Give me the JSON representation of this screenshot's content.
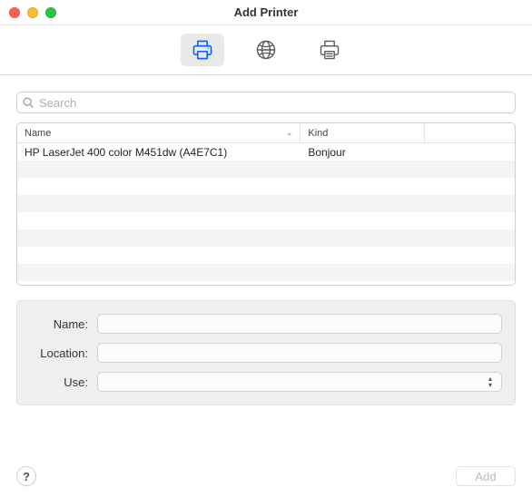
{
  "window": {
    "title": "Add Printer"
  },
  "toolbar": {
    "tabs": [
      {
        "name": "default-printer",
        "active": true
      },
      {
        "name": "ip-printer",
        "active": false
      },
      {
        "name": "windows-printer",
        "active": false
      }
    ]
  },
  "search": {
    "placeholder": "Search",
    "value": ""
  },
  "table": {
    "columns": {
      "name": "Name",
      "kind": "Kind"
    },
    "rows": [
      {
        "name": "HP LaserJet 400 color M451dw (A4E7C1)",
        "kind": "Bonjour"
      }
    ],
    "visible_row_slots": 8
  },
  "details": {
    "labels": {
      "name": "Name:",
      "location": "Location:",
      "use": "Use:"
    },
    "values": {
      "name": "",
      "location": "",
      "use": ""
    }
  },
  "footer": {
    "help_label": "?",
    "add_label": "Add",
    "add_enabled": false
  },
  "colors": {
    "accent": "#0a60ff",
    "icon_muted": "#5c5c5d"
  }
}
